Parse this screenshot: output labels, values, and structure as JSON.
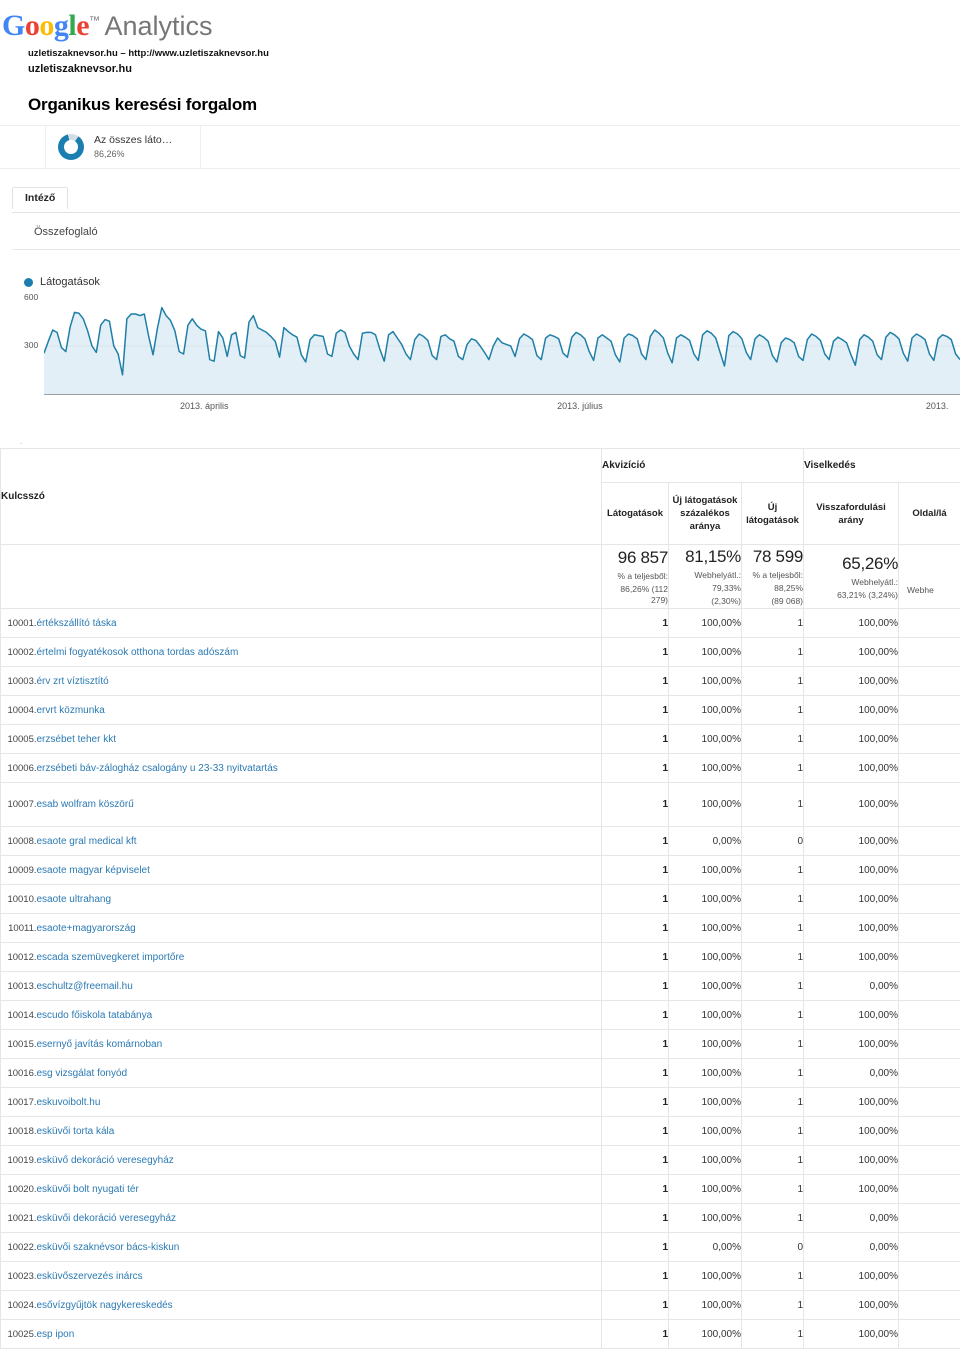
{
  "brand": {
    "google": [
      "G",
      "o",
      "o",
      "g",
      "l",
      "e"
    ],
    "tm": "™",
    "product": "Analytics"
  },
  "property": {
    "line1": "uzletiszaknevsor.hu – http://www.uzletiszaknevsor.hu",
    "line2": "uzletiszaknevsor.hu"
  },
  "report": {
    "title": "Organikus keresési forgalom"
  },
  "segment": {
    "name": "Az összes láto…",
    "value": "86,26%"
  },
  "tabs": {
    "explorer": "Intéző",
    "summary": "Összefoglaló"
  },
  "chart": {
    "legend_label": "Látogatások"
  },
  "chart_data": {
    "type": "area",
    "title": "Látogatások",
    "xlabel": "",
    "ylabel": "Látogatások",
    "ylim": [
      0,
      600
    ],
    "yticks": [
      300,
      600
    ],
    "ytick_labels": [
      "300",
      "600"
    ],
    "grid": false,
    "legend_position": "top-left",
    "line_color": "#1f7fa8",
    "fill_color": "#e2eff6",
    "x_tick_labels": [
      "2013. április",
      "2013. július",
      "2013."
    ],
    "x_tick_positions_pct": [
      17.5,
      58.5,
      97.5
    ],
    "series": [
      {
        "name": "Látogatások",
        "values": [
          255,
          330,
          400,
          385,
          290,
          265,
          420,
          510,
          505,
          470,
          395,
          300,
          260,
          430,
          465,
          455,
          300,
          250,
          120,
          470,
          500,
          500,
          490,
          500,
          360,
          245,
          410,
          540,
          490,
          460,
          395,
          265,
          250,
          430,
          470,
          430,
          405,
          395,
          215,
          205,
          390,
          350,
          235,
          370,
          385,
          240,
          225,
          450,
          490,
          415,
          400,
          385,
          360,
          330,
          230,
          415,
          390,
          370,
          355,
          245,
          200,
          340,
          370,
          365,
          360,
          250,
          235,
          380,
          400,
          385,
          300,
          250,
          215,
          380,
          385,
          385,
          370,
          280,
          205,
          370,
          390,
          350,
          310,
          250,
          215,
          340,
          375,
          360,
          335,
          240,
          215,
          360,
          370,
          345,
          330,
          235,
          215,
          310,
          345,
          335,
          300,
          260,
          215,
          300,
          350,
          320,
          310,
          300,
          235,
          345,
          375,
          360,
          340,
          240,
          215,
          350,
          370,
          360,
          345,
          255,
          230,
          355,
          385,
          370,
          345,
          265,
          210,
          350,
          370,
          350,
          330,
          245,
          200,
          350,
          375,
          365,
          345,
          250,
          215,
          360,
          400,
          380,
          350,
          255,
          195,
          350,
          370,
          355,
          335,
          250,
          210,
          370,
          395,
          380,
          350,
          260,
          175,
          365,
          390,
          375,
          345,
          260,
          215,
          345,
          370,
          355,
          330,
          240,
          200,
          320,
          350,
          340,
          320,
          235,
          210,
          340,
          375,
          360,
          335,
          250,
          215,
          330,
          355,
          340,
          320,
          245,
          180,
          340,
          370,
          355,
          330,
          245,
          215,
          355,
          385,
          370,
          345,
          255,
          205,
          350,
          375,
          360,
          340,
          250,
          210,
          345,
          370,
          360,
          340,
          250,
          215
        ]
      }
    ]
  },
  "table": {
    "groups": {
      "acquisition": "Akvizíció",
      "behavior": "Viselkedés"
    },
    "dimension_header": "Kulcsszó",
    "columns": [
      "Látogatások",
      "Új látogatások százalékos aránya",
      "Új látogatások",
      "Visszafordulási arány",
      "Oldal/lá"
    ],
    "summary": [
      {
        "big": "96 857",
        "sub1": "% a teljesből:",
        "sub2": "86,26% (112 279)",
        "sub3": ""
      },
      {
        "big": "81,15%",
        "sub1": "Webhelyátl.:",
        "sub2": "79,33%",
        "sub3": "(2,30%)"
      },
      {
        "big": "78 599",
        "sub1": "% a teljesből:",
        "sub2": "88,25%",
        "sub3": "(89 068)"
      },
      {
        "big": "65,26%",
        "sub1": "Webhelyátl.:",
        "sub2": "63,21% (3,24%)",
        "sub3": ""
      },
      {
        "big": "",
        "sub1": "Webhe",
        "sub2": "",
        "sub3": ""
      }
    ],
    "rows": [
      {
        "rank": "10001.",
        "keyword": "értékszállító táska",
        "visits": "1",
        "new_pct": "100,00%",
        "new_visits": "1",
        "bounce": "100,00%"
      },
      {
        "rank": "10002.",
        "keyword": "értelmi fogyatékosok otthona tordas adószám",
        "visits": "1",
        "new_pct": "100,00%",
        "new_visits": "1",
        "bounce": "100,00%"
      },
      {
        "rank": "10003.",
        "keyword": "érv zrt víztisztító",
        "visits": "1",
        "new_pct": "100,00%",
        "new_visits": "1",
        "bounce": "100,00%"
      },
      {
        "rank": "10004.",
        "keyword": "ervrt közmunka",
        "visits": "1",
        "new_pct": "100,00%",
        "new_visits": "1",
        "bounce": "100,00%"
      },
      {
        "rank": "10005.",
        "keyword": "erzsébet teher kkt",
        "visits": "1",
        "new_pct": "100,00%",
        "new_visits": "1",
        "bounce": "100,00%"
      },
      {
        "rank": "10006.",
        "keyword": "erzsébeti báv-zálogház csalogány u 23-33 nyitvatartás",
        "visits": "1",
        "new_pct": "100,00%",
        "new_visits": "1",
        "bounce": "100,00%"
      },
      {
        "rank": "10007.",
        "keyword": "esab wolfram köszörű",
        "visits": "1",
        "new_pct": "100,00%",
        "new_visits": "1",
        "bounce": "100,00%",
        "tall": true
      },
      {
        "rank": "10008.",
        "keyword": "esaote gral medical kft",
        "visits": "1",
        "new_pct": "0,00%",
        "new_visits": "0",
        "bounce": "100,00%"
      },
      {
        "rank": "10009.",
        "keyword": "esaote magyar képviselet",
        "visits": "1",
        "new_pct": "100,00%",
        "new_visits": "1",
        "bounce": "100,00%"
      },
      {
        "rank": "10010.",
        "keyword": "esaote ultrahang",
        "visits": "1",
        "new_pct": "100,00%",
        "new_visits": "1",
        "bounce": "100,00%"
      },
      {
        "rank": "10011.",
        "keyword": "esaote+magyarország",
        "visits": "1",
        "new_pct": "100,00%",
        "new_visits": "1",
        "bounce": "100,00%"
      },
      {
        "rank": "10012.",
        "keyword": "escada szemüvegkeret importőre",
        "visits": "1",
        "new_pct": "100,00%",
        "new_visits": "1",
        "bounce": "100,00%"
      },
      {
        "rank": "10013.",
        "keyword": "eschultz@freemail.hu",
        "visits": "1",
        "new_pct": "100,00%",
        "new_visits": "1",
        "bounce": "0,00%"
      },
      {
        "rank": "10014.",
        "keyword": "escudo főiskola tatabánya",
        "visits": "1",
        "new_pct": "100,00%",
        "new_visits": "1",
        "bounce": "100,00%"
      },
      {
        "rank": "10015.",
        "keyword": "esernyő javítás komárnoban",
        "visits": "1",
        "new_pct": "100,00%",
        "new_visits": "1",
        "bounce": "100,00%"
      },
      {
        "rank": "10016.",
        "keyword": "esg vizsgálat fonyód",
        "visits": "1",
        "new_pct": "100,00%",
        "new_visits": "1",
        "bounce": "0,00%"
      },
      {
        "rank": "10017.",
        "keyword": "eskuvoibolt.hu",
        "visits": "1",
        "new_pct": "100,00%",
        "new_visits": "1",
        "bounce": "100,00%"
      },
      {
        "rank": "10018.",
        "keyword": "esküvői torta kála",
        "visits": "1",
        "new_pct": "100,00%",
        "new_visits": "1",
        "bounce": "100,00%"
      },
      {
        "rank": "10019.",
        "keyword": "esküvő dekoráció veresegyház",
        "visits": "1",
        "new_pct": "100,00%",
        "new_visits": "1",
        "bounce": "100,00%"
      },
      {
        "rank": "10020.",
        "keyword": "esküvői bolt nyugati tér",
        "visits": "1",
        "new_pct": "100,00%",
        "new_visits": "1",
        "bounce": "100,00%"
      },
      {
        "rank": "10021.",
        "keyword": "esküvői dekoráció veresegyház",
        "visits": "1",
        "new_pct": "100,00%",
        "new_visits": "1",
        "bounce": "0,00%"
      },
      {
        "rank": "10022.",
        "keyword": "esküvői szaknévsor bács-kiskun",
        "visits": "1",
        "new_pct": "0,00%",
        "new_visits": "0",
        "bounce": "0,00%"
      },
      {
        "rank": "10023.",
        "keyword": "esküvőszervezés inárcs",
        "visits": "1",
        "new_pct": "100,00%",
        "new_visits": "1",
        "bounce": "100,00%"
      },
      {
        "rank": "10024.",
        "keyword": "esővízgyűjtök nagykereskedés",
        "visits": "1",
        "new_pct": "100,00%",
        "new_visits": "1",
        "bounce": "100,00%"
      },
      {
        "rank": "10025.",
        "keyword": "esp ipon",
        "visits": "1",
        "new_pct": "100,00%",
        "new_visits": "1",
        "bounce": "100,00%"
      }
    ]
  }
}
